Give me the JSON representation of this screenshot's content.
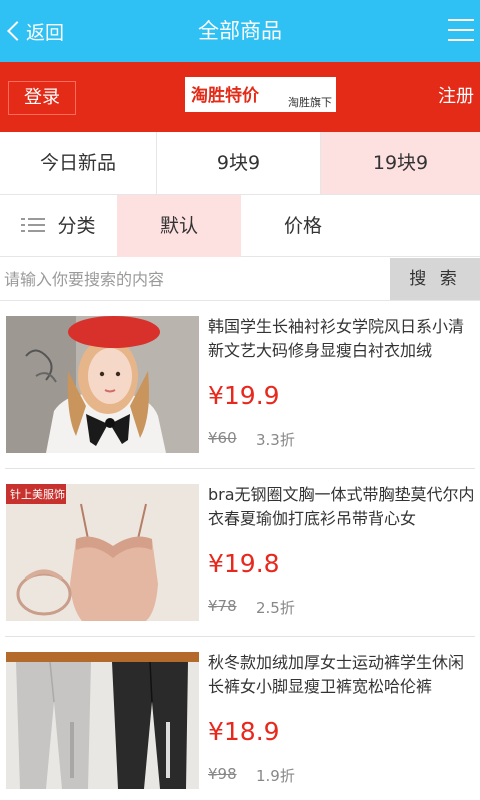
{
  "header": {
    "back_label": "返回",
    "title": "全部商品"
  },
  "brand": {
    "login_label": "登录",
    "logo_main": "淘胜特价",
    "logo_sub": "淘胜旗下",
    "register_label": "注册"
  },
  "category_tabs": [
    {
      "label": "今日新品"
    },
    {
      "label": "9块9"
    },
    {
      "label": "19块9"
    }
  ],
  "sort": {
    "category_label": "分类",
    "default_label": "默认",
    "price_label": "价格"
  },
  "search": {
    "placeholder": "请输入你要搜索的内容",
    "button_label": "搜 索"
  },
  "products": [
    {
      "name": "韩国学生长袖衬衫女学院风日系小清新文艺大码修身显瘦白衬衣加绒",
      "price": "¥19.9",
      "original": "¥60",
      "discount": "3.3折"
    },
    {
      "name": "bra无钢圈文胸一体式带胸垫莫代尔内衣春夏瑜伽打底衫吊带背心女",
      "price": "¥19.8",
      "original": "¥78",
      "discount": "2.5折",
      "image_badge": "针上美服饰"
    },
    {
      "name": "秋冬款加绒加厚女士运动裤学生休闲长裤女小脚显瘦卫裤宽松哈伦裤",
      "price": "¥18.9",
      "original": "¥98",
      "discount": "1.9折"
    }
  ],
  "colors": {
    "header_bg": "#2fc0f4",
    "brand_bg": "#e32b18",
    "active_tab_bg": "#fde0e0",
    "price": "#e8281c"
  }
}
